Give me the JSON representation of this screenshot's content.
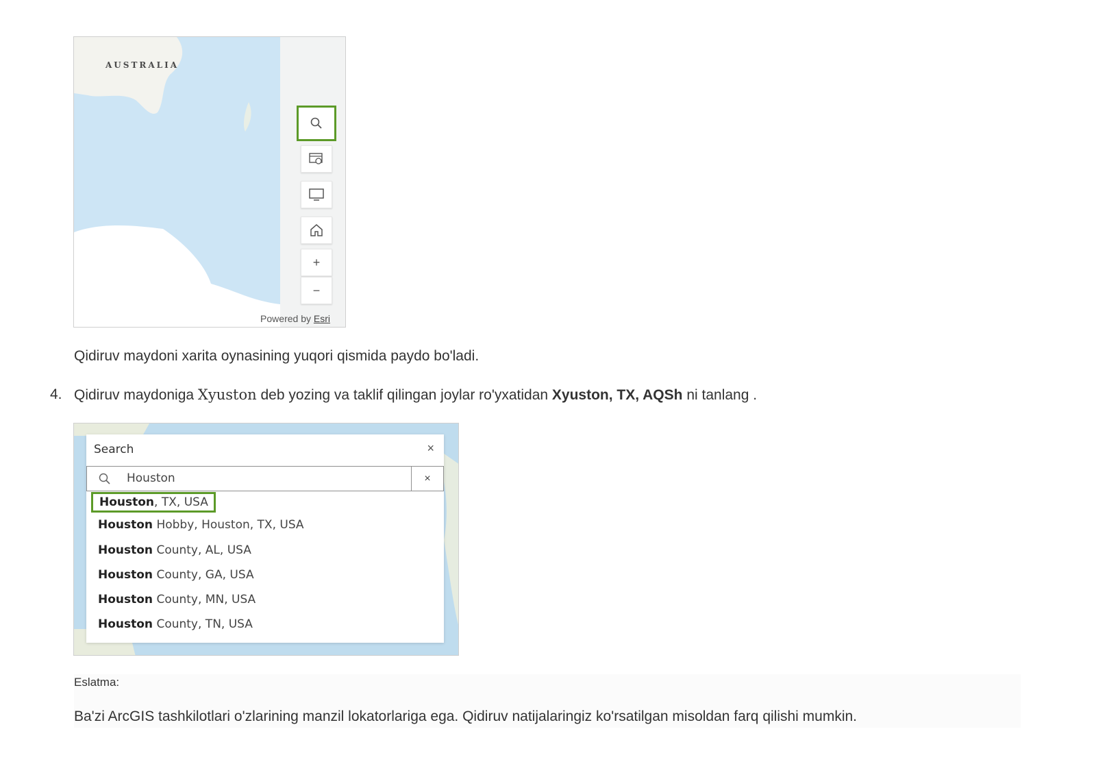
{
  "figure1": {
    "map_label": "AUSTRALIA",
    "powered_by": "Powered by",
    "powered_link": "Esri",
    "tools": [
      "search-icon",
      "basemap-gallery-icon",
      "monitor-icon",
      "home-icon",
      "zoom-in-icon",
      "zoom-out-icon"
    ],
    "zoom_in": "+",
    "zoom_out": "−",
    "highlight_color": "#5c9a28"
  },
  "text": {
    "caption1": "Qidiruv maydoni xarita oynasining yuqori qismida paydo bo'ladi.",
    "step_number": "4.",
    "step_part1": "Qidiruv maydoniga ",
    "step_term": "Xyuston",
    "step_part2": " deb yozing va taklif qilingan joylar ro'yxatidan ",
    "step_bold": "Xyuston, TX, AQSh",
    "step_part3": " ni tanlang ."
  },
  "figure2": {
    "panel_title": "Search",
    "close_symbol": "×",
    "input_value": "Houston",
    "clear_symbol": "×",
    "results": [
      {
        "bold": "Houston",
        "rest": ", TX, USA"
      },
      {
        "bold": "Houston",
        "rest": " Hobby, Houston, TX, USA"
      },
      {
        "bold": "Houston",
        "rest": " County, AL, USA"
      },
      {
        "bold": "Houston",
        "rest": " County, GA, USA"
      },
      {
        "bold": "Houston",
        "rest": " County, MN, USA"
      },
      {
        "bold": "Houston",
        "rest": " County, TN, USA"
      }
    ]
  },
  "note": {
    "label": "Eslatma:",
    "body": "Ba'zi ArcGIS tashkilotlari o'zlarining manzil lokatorlariga ega. Qidiruv natijalaringiz ko'rsatilgan misoldan farq qilishi mumkin."
  }
}
